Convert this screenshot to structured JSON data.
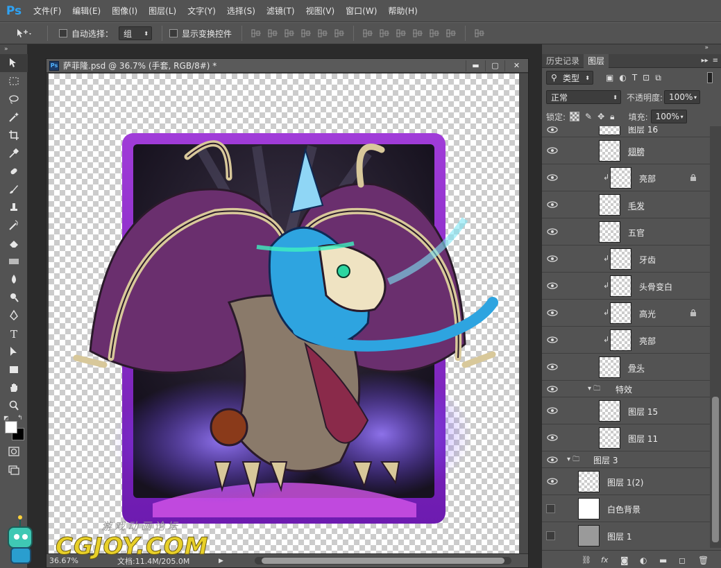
{
  "app": {
    "logo": "Ps",
    "accent": "#2fa3f4"
  },
  "menu": [
    "文件(F)",
    "编辑(E)",
    "图像(I)",
    "图层(L)",
    "文字(Y)",
    "选择(S)",
    "滤镜(T)",
    "视图(V)",
    "窗口(W)",
    "帮助(H)"
  ],
  "options": {
    "auto_select_label": "自动选择：",
    "auto_select_value": "组",
    "show_transform_label": "显示变换控件"
  },
  "document": {
    "title": "萨菲隆.psd @ 36.7% (手套, RGB/8#) *",
    "zoom": "36.67%",
    "doc_info": "文档:11.4M/205.0M"
  },
  "panel": {
    "tabs": [
      "历史记录",
      "图层"
    ],
    "active_tab": "图层",
    "filter_kind": "类型",
    "blend_mode": "正常",
    "opacity_label": "不透明度:",
    "opacity_value": "100%",
    "lock_label": "锁定:",
    "fill_label": "填充:",
    "fill_value": "100%"
  },
  "layers": [
    {
      "name": "图层 16",
      "visible": true,
      "clip": false,
      "lock": false,
      "partial": true
    },
    {
      "name": "翅膀",
      "visible": true,
      "clip": false,
      "lock": false,
      "linked": true
    },
    {
      "name": "亮部",
      "visible": true,
      "clip": true,
      "lock": true
    },
    {
      "name": "毛发",
      "visible": true,
      "clip": false,
      "lock": false,
      "linked": true
    },
    {
      "name": "五官",
      "visible": true,
      "clip": false,
      "lock": false
    },
    {
      "name": "牙齿",
      "visible": true,
      "clip": true,
      "lock": false
    },
    {
      "name": "头骨变白",
      "visible": true,
      "clip": true,
      "lock": false
    },
    {
      "name": "高光",
      "visible": true,
      "clip": true,
      "lock": true
    },
    {
      "name": "亮部",
      "visible": true,
      "clip": true,
      "lock": false
    },
    {
      "name": "骨头",
      "visible": true,
      "clip": false,
      "lock": false,
      "linked": true
    },
    {
      "name": "特效",
      "visible": true,
      "group": true
    },
    {
      "name": "图层 15",
      "visible": true,
      "clip": false,
      "lock": false
    },
    {
      "name": "图层 11",
      "visible": true,
      "clip": false,
      "lock": false
    },
    {
      "name": "图层 3",
      "visible": true,
      "group": true,
      "outer": true
    },
    {
      "name": "图层 1(2)",
      "visible": true,
      "outer": true
    },
    {
      "name": "白色背景",
      "visible": false,
      "outer": true,
      "thumb": "#ffffff"
    },
    {
      "name": "图层 1",
      "visible": false,
      "outer": true,
      "thumb": "#9a9a9a"
    }
  ],
  "watermark": {
    "line1": "游戏动画论坛",
    "line2": "CGJOY.COM"
  }
}
